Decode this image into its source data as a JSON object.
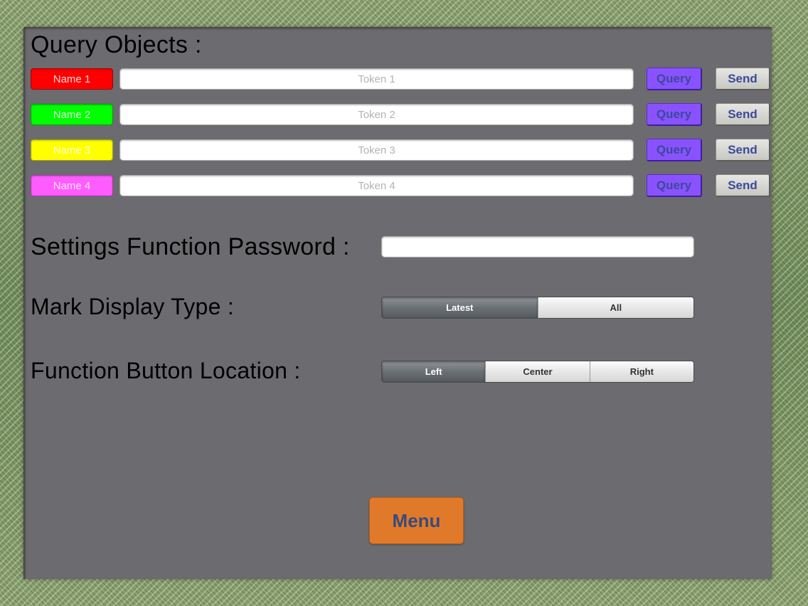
{
  "query_objects": {
    "title": "Query Objects :",
    "rows": [
      {
        "name": "Name 1",
        "name_color": "#ff0000",
        "token_placeholder": "Token 1",
        "query_label": "Query",
        "send_label": "Send"
      },
      {
        "name": "Name 2",
        "name_color": "#00ff00",
        "token_placeholder": "Token 2",
        "query_label": "Query",
        "send_label": "Send"
      },
      {
        "name": "Name 3",
        "name_color": "#ffff00",
        "token_placeholder": "Token 3",
        "query_label": "Query",
        "send_label": "Send"
      },
      {
        "name": "Name 4",
        "name_color": "#ff5cff",
        "token_placeholder": "Token 4",
        "query_label": "Query",
        "send_label": "Send"
      }
    ]
  },
  "settings_password": {
    "label": "Settings Function Password :",
    "value": ""
  },
  "mark_display_type": {
    "label": "Mark Display Type :",
    "options": [
      "Latest",
      "All"
    ],
    "selected": "Latest"
  },
  "function_button_location": {
    "label": "Function Button Location :",
    "options": [
      "Left",
      "Center",
      "Right"
    ],
    "selected": "Left"
  },
  "menu_button": {
    "label": "Menu",
    "color": "#e07a2a"
  },
  "colors": {
    "panel_bg": "#6c6b6f",
    "query_button": "#8a52ff",
    "button_text": "#3a4a9a"
  }
}
